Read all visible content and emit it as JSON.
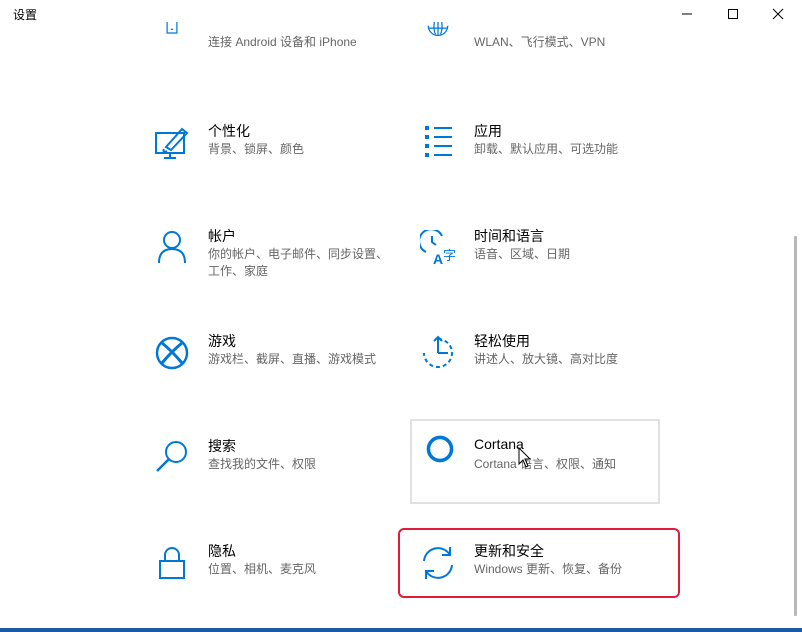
{
  "window": {
    "title": "设置"
  },
  "tiles": {
    "phone": {
      "title": "",
      "desc": "连接 Android 设备和 iPhone"
    },
    "network": {
      "title": "",
      "desc": "WLAN、飞行模式、VPN"
    },
    "personalization": {
      "title": "个性化",
      "desc": "背景、锁屏、颜色"
    },
    "apps": {
      "title": "应用",
      "desc": "卸载、默认应用、可选功能"
    },
    "accounts": {
      "title": "帐户",
      "desc": "你的帐户、电子邮件、同步设置、工作、家庭"
    },
    "time_language": {
      "title": "时间和语言",
      "desc": "语音、区域、日期"
    },
    "gaming": {
      "title": "游戏",
      "desc": "游戏栏、截屏、直播、游戏模式"
    },
    "ease_of_access": {
      "title": "轻松使用",
      "desc": "讲述人、放大镜、高对比度"
    },
    "search": {
      "title": "搜索",
      "desc": "查找我的文件、权限"
    },
    "cortana": {
      "title": "Cortana",
      "desc": "Cortana 语言、权限、通知"
    },
    "privacy": {
      "title": "隐私",
      "desc": "位置、相机、麦克风"
    },
    "update_security": {
      "title": "更新和安全",
      "desc": "Windows 更新、恢复、备份"
    }
  },
  "icons": {
    "phone": "phone-icon",
    "network": "globe-icon",
    "personalization": "paint-monitor-icon",
    "apps": "app-list-icon",
    "accounts": "person-icon",
    "time_language": "clock-language-icon",
    "gaming": "xbox-icon",
    "ease_of_access": "accessibility-timer-icon",
    "search": "magnifier-icon",
    "cortana": "cortana-circle-icon",
    "privacy": "lock-icon",
    "update_security": "sync-arrows-icon"
  },
  "colors": {
    "accent": "#0078d7",
    "highlight": "#e21b3c",
    "description": "#666666"
  }
}
